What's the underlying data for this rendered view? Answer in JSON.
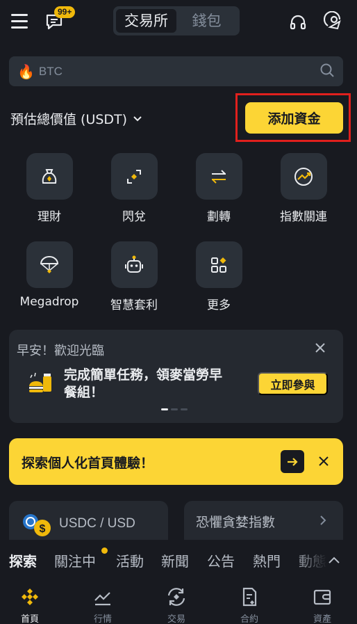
{
  "header": {
    "message_badge": "99+",
    "tabs": [
      {
        "label": "交易所",
        "active": true
      },
      {
        "label": "錢包",
        "active": false
      }
    ]
  },
  "search": {
    "placeholder": "BTC",
    "icon": "fire-icon"
  },
  "balance": {
    "label": "預估總價值 (USDT)",
    "add_funds_label": "添加資金"
  },
  "shortcuts": [
    {
      "label": "理財",
      "icon": "money-bag-icon"
    },
    {
      "label": "閃兌",
      "icon": "convert-icon"
    },
    {
      "label": "劃轉",
      "icon": "transfer-icon"
    },
    {
      "label": "指數關連",
      "icon": "index-link-icon"
    },
    {
      "label": "Megadrop",
      "icon": "parachute-icon"
    },
    {
      "label": "智慧套利",
      "icon": "robot-icon"
    },
    {
      "label": "更多",
      "icon": "more-grid-icon"
    }
  ],
  "welcome": {
    "title": "早安！歡迎光臨",
    "text": "完成簡單任務，領麥當勞早餐組！",
    "cta": "立即參與"
  },
  "banner": {
    "text": "探索個人化首頁體驗！"
  },
  "market_cards": {
    "pair": "USDC / USD",
    "fear_greed": "恐懼貪婪指數"
  },
  "categories": [
    {
      "label": "探索",
      "active": true
    },
    {
      "label": "關注中",
      "active": false,
      "dot": true
    },
    {
      "label": "活動",
      "active": false
    },
    {
      "label": "新聞",
      "active": false
    },
    {
      "label": "公告",
      "active": false
    },
    {
      "label": "熱門",
      "active": false
    },
    {
      "label": "動態",
      "active": false
    }
  ],
  "bottom_nav": [
    {
      "label": "首頁",
      "active": true,
      "icon": "home-icon"
    },
    {
      "label": "行情",
      "active": false,
      "icon": "markets-icon"
    },
    {
      "label": "交易",
      "active": false,
      "icon": "trade-icon"
    },
    {
      "label": "合約",
      "active": false,
      "icon": "futures-icon"
    },
    {
      "label": "資產",
      "active": false,
      "icon": "wallet-icon"
    }
  ],
  "colors": {
    "background": "#181a20",
    "surface": "#2b3139",
    "accent": "#fcd535",
    "highlight_frame": "#e0201d"
  }
}
